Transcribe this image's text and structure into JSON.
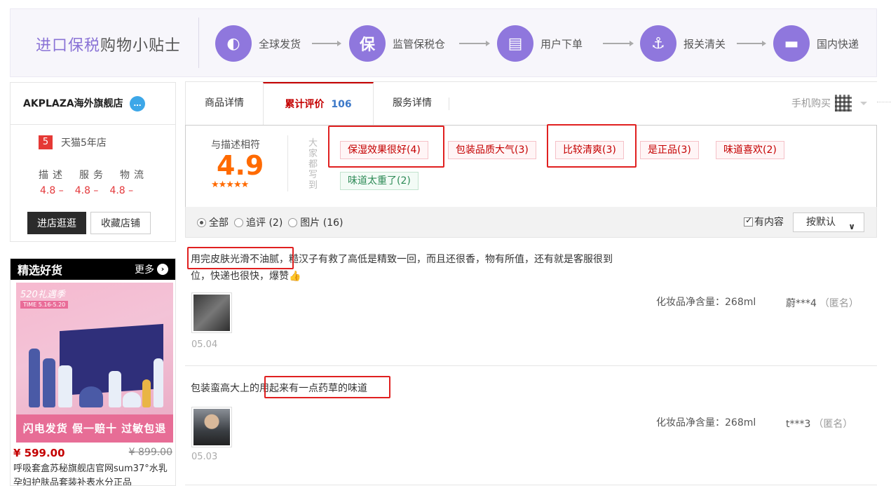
{
  "banner": {
    "title_highlight": "进口保税",
    "title_rest": "购物小贴士",
    "steps": [
      {
        "label": "全球发货",
        "icon": "globe-icon",
        "glyph": "◐"
      },
      {
        "label": "监管保税仓",
        "icon": "bonded-icon",
        "glyph": "保"
      },
      {
        "label": "用户下单",
        "icon": "clipboard-icon",
        "glyph": "▤"
      },
      {
        "label": "报关清关",
        "icon": "anchor-icon",
        "glyph": "⚓"
      },
      {
        "label": "国内快递",
        "icon": "truck-icon",
        "glyph": "▬"
      }
    ]
  },
  "shop": {
    "name": "AKPLAZA海外旗舰店",
    "badge": "…",
    "tmall_years_num": "5",
    "tmall_years_label": "天猫5年店",
    "rating_labels": [
      "描述",
      "服务",
      "物流"
    ],
    "rating_values": [
      "4.8 –",
      "4.8 –",
      "4.8 –"
    ],
    "enter_label": "进店逛逛",
    "favorite_label": "收藏店铺"
  },
  "picks": {
    "title": "精选好货",
    "more_label": "更多",
    "product": {
      "promo_tag": "520礼遇季",
      "promo_date": "TIME 5.16-5.20",
      "promo_banner": "闪电发货 假一赔十 过敏包退",
      "price_now": "¥ 599.00",
      "price_old": "¥ 899.00",
      "name": "呼吸套盒苏秘旗舰店官网sum37°水乳孕妇护肤品套装补表水分正品"
    }
  },
  "tabs": {
    "items": [
      {
        "label": "商品详情"
      },
      {
        "label": "累计评价",
        "count": "106"
      },
      {
        "label": "服务详情"
      }
    ],
    "mobile_buy": "手机购买"
  },
  "summary": {
    "score_label": "与描述相符",
    "score": "4.9",
    "stars": "★★★★★",
    "everyone_label": "大家都写到",
    "tags": [
      {
        "label": "保湿效果很好(4)"
      },
      {
        "label": "包装品质大气(3)"
      },
      {
        "label": "比较清爽(3)"
      },
      {
        "label": "是正品(3)"
      },
      {
        "label": "味道喜欢(2)"
      },
      {
        "label": "味道太重了(2)",
        "negative": true
      }
    ]
  },
  "filter": {
    "all": "全部",
    "followup": "追评 (2)",
    "pictures": "图片 (16)",
    "has_content": "有内容",
    "sort": "按默认"
  },
  "reviews": [
    {
      "text_highlight": "用完皮肤光滑不油腻",
      "text_rest": "，糙汉子有救了高低是精致一回，而且还很香，物有所值，还有就是客服很到位，快递也很快，爆赞👍",
      "date": "05.04",
      "spec": "化妆品净含量：268ml",
      "user": "蔚***4",
      "anon": "（匿名）"
    },
    {
      "text_prefix": "包装蛮高大上的",
      "text_highlight": "用起来有一点药草的味道",
      "date": "05.03",
      "spec": "化妆品净含量：268ml",
      "user": "t***3",
      "anon": "（匿名）"
    }
  ]
}
